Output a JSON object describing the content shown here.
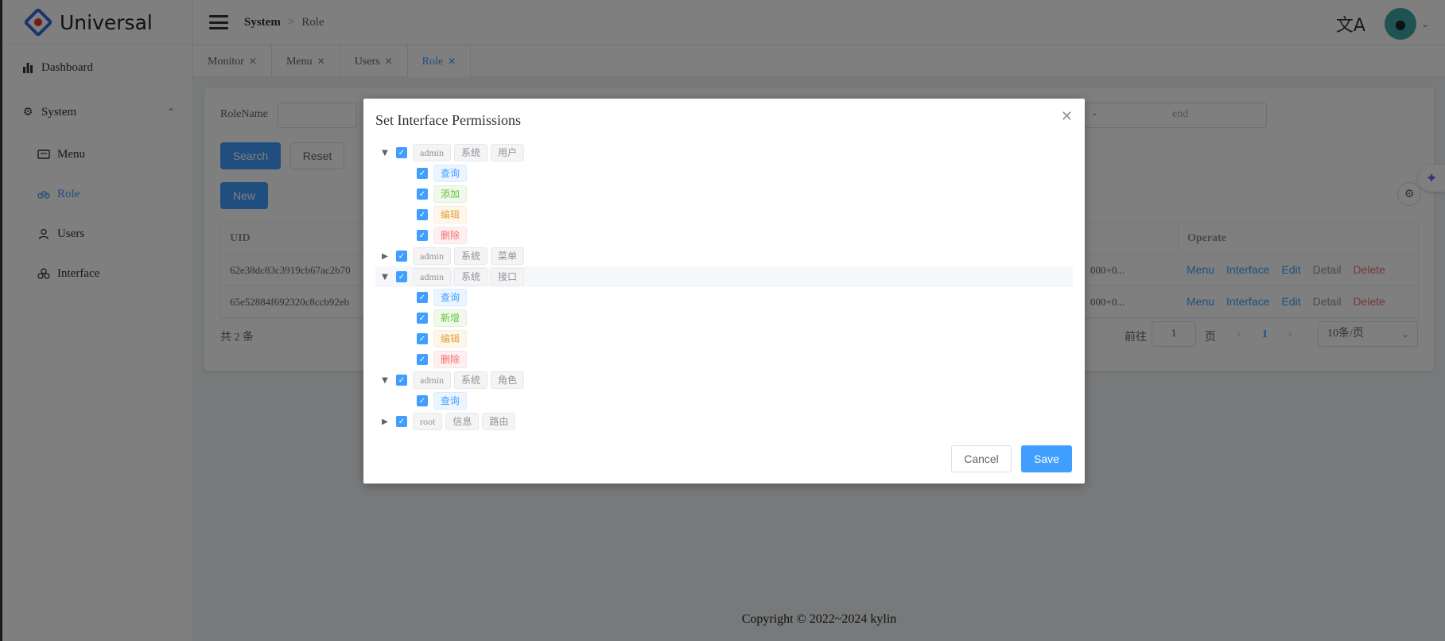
{
  "app": {
    "title": "Universal"
  },
  "sidebar": {
    "items": [
      {
        "label": "Dashboard",
        "icon": "bar-chart-icon"
      },
      {
        "label": "System",
        "icon": "gear-icon"
      },
      {
        "label": "Menu",
        "icon": "menu-icon"
      },
      {
        "label": "Role",
        "icon": "bike-icon"
      },
      {
        "label": "Users",
        "icon": "user-icon"
      },
      {
        "label": "Interface",
        "icon": "interface-icon"
      }
    ]
  },
  "header": {
    "breadcrumb": [
      "System",
      ">",
      "Role"
    ]
  },
  "tabs": [
    {
      "label": "Monitor"
    },
    {
      "label": "Menu"
    },
    {
      "label": "Users"
    },
    {
      "label": "Role"
    }
  ],
  "search": {
    "role_name_label": "RoleName",
    "date_separator": "-",
    "end_placeholder": "end",
    "search_label": "Search",
    "reset_label": "Reset",
    "new_label": "New"
  },
  "table": {
    "headers": {
      "uid": "UID",
      "operate": "Operate"
    },
    "rows": [
      {
        "uid": "62e38dc83c3919cb67ac2b70",
        "time": "000+0..."
      },
      {
        "uid": "65e52884f692320c8ccb92eb",
        "time": "000+0..."
      }
    ],
    "ops": {
      "menu": "Menu",
      "interface": "Interface",
      "edit": "Edit",
      "detail": "Detail",
      "delete": "Delete"
    },
    "colors": {
      "link": "#409eff",
      "danger": "#f56c6c",
      "muted": "#909399"
    }
  },
  "pagination": {
    "total": "共 2 条",
    "goto": "前往",
    "page_value": "1",
    "page_unit": "页",
    "current": "1",
    "page_size": "10条/页"
  },
  "dialog": {
    "title": "Set Interface Permissions",
    "cancel_label": "Cancel",
    "save_label": "Save",
    "tree": [
      {
        "tags": [
          "admin",
          "系统",
          "用户"
        ],
        "expanded": true,
        "children": [
          "查询",
          "添加",
          "编辑",
          "删除"
        ]
      },
      {
        "tags": [
          "admin",
          "系统",
          "菜单"
        ],
        "expanded": false
      },
      {
        "tags": [
          "admin",
          "系统",
          "接口"
        ],
        "expanded": true,
        "children": [
          "查询",
          "新增",
          "编辑",
          "删除"
        ]
      },
      {
        "tags": [
          "admin",
          "系统",
          "角色"
        ],
        "expanded": true,
        "children": [
          "查询"
        ]
      },
      {
        "tags": [
          "root",
          "信息",
          "路由"
        ],
        "expanded": false
      }
    ]
  },
  "footer": {
    "copyright": "Copyright © 2022~2024 kylin"
  }
}
